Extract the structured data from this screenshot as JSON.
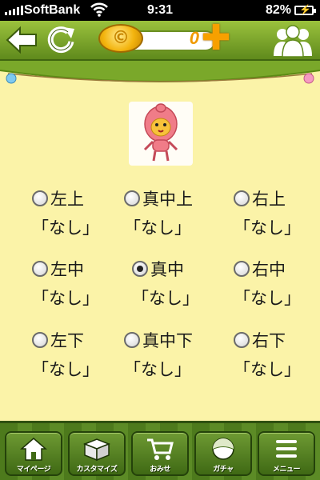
{
  "status_bar": {
    "carrier": "SoftBank",
    "time": "9:31",
    "battery": "82%"
  },
  "top_bar": {
    "coin_count": "0",
    "icons": {
      "back": "back-arrow-icon",
      "reload": "reload-icon",
      "coin": "coin-icon",
      "add": "plus-icon",
      "friends": "friends-icon"
    }
  },
  "positions": [
    {
      "label": "左上",
      "value": "「なし」",
      "checked": false
    },
    {
      "label": "真中上",
      "value": "「なし」",
      "checked": false
    },
    {
      "label": "右上",
      "value": "「なし」",
      "checked": false
    },
    {
      "label": "左中",
      "value": "「なし」",
      "checked": false
    },
    {
      "label": "真中",
      "value": "「なし」",
      "checked": true
    },
    {
      "label": "右中",
      "value": "「なし」",
      "checked": false
    },
    {
      "label": "左下",
      "value": "「なし」",
      "checked": false
    },
    {
      "label": "真中下",
      "value": "「なし」",
      "checked": false
    },
    {
      "label": "右下",
      "value": "「なし」",
      "checked": false
    }
  ],
  "tab_bar": [
    {
      "label": "マイページ",
      "icon": "house-icon"
    },
    {
      "label": "カスタマイズ",
      "icon": "box-icon"
    },
    {
      "label": "おみせ",
      "icon": "cart-icon"
    },
    {
      "label": "ガチャ",
      "icon": "ball-icon"
    },
    {
      "label": "メニュー",
      "icon": "menu-icon"
    }
  ],
  "colors": {
    "background": "#fbf3a8",
    "bar_green": "#5f8a1c",
    "coin_orange": "#f09a00"
  }
}
